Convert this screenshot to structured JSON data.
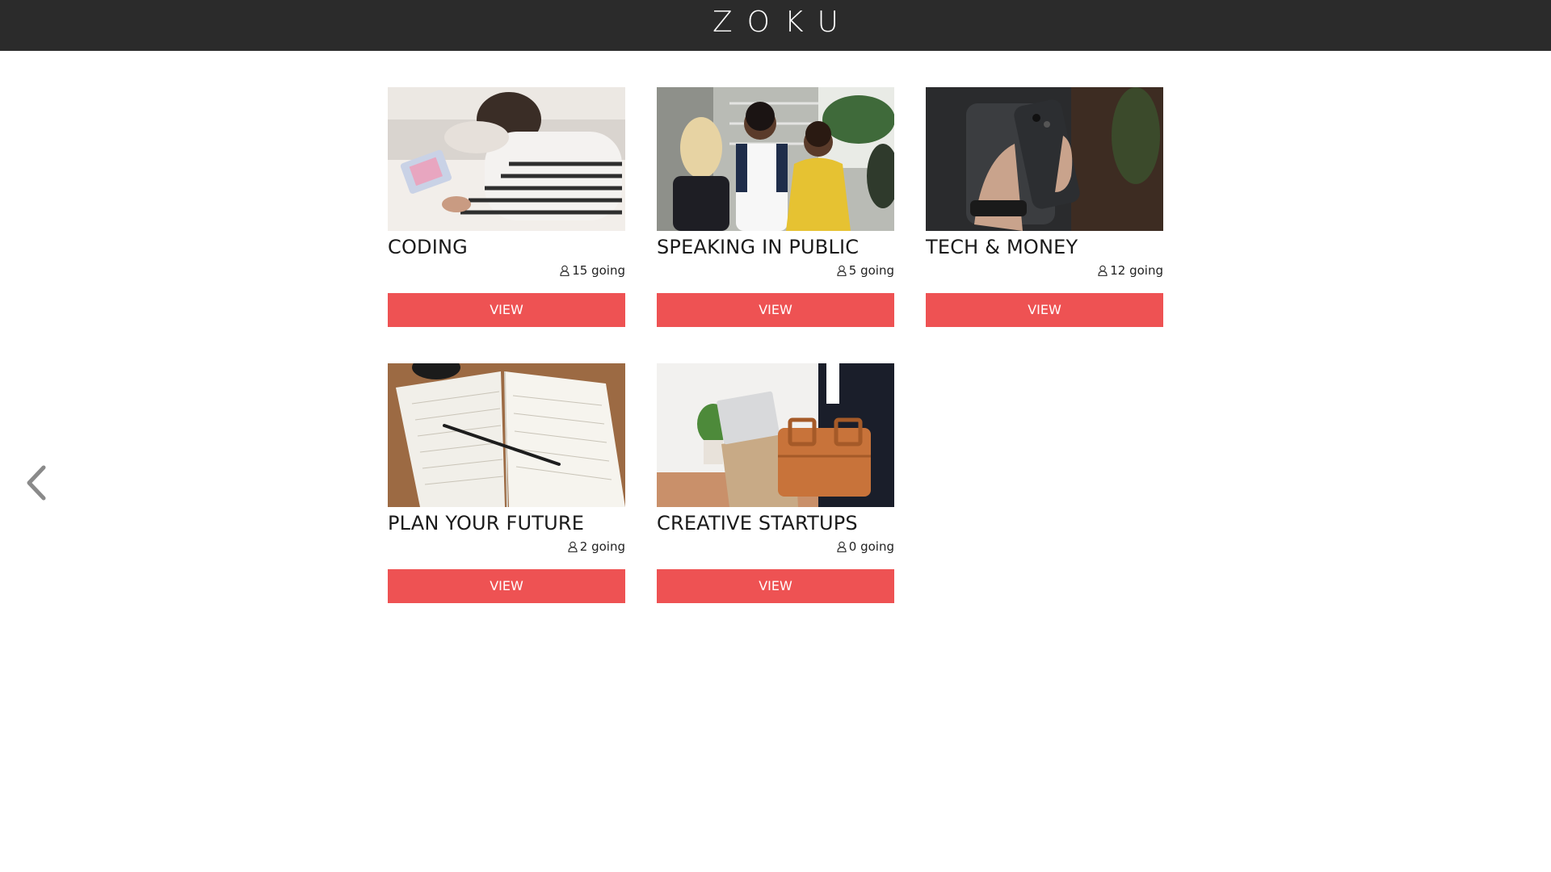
{
  "header": {
    "logo": "ZOKU"
  },
  "nav": {
    "back_icon": "chevron-left-icon"
  },
  "colors": {
    "topbar": "#2b2b2b",
    "accent": "#ee5253"
  },
  "cards": [
    {
      "title": "CODING",
      "going": "15 going",
      "button": "VIEW",
      "image": "person-using-tablet"
    },
    {
      "title": "SPEAKING IN PUBLIC",
      "going": "5 going",
      "button": "VIEW",
      "image": "people-talking-on-stairs"
    },
    {
      "title": "TECH & MONEY",
      "going": "12 going",
      "button": "VIEW",
      "image": "hand-holding-phone"
    },
    {
      "title": "PLAN YOUR FUTURE",
      "going": "2 going",
      "button": "VIEW",
      "image": "notebook-and-pencil"
    },
    {
      "title": "CREATIVE STARTUPS",
      "going": "0 going",
      "button": "VIEW",
      "image": "man-with-laptop-and-bag"
    }
  ]
}
